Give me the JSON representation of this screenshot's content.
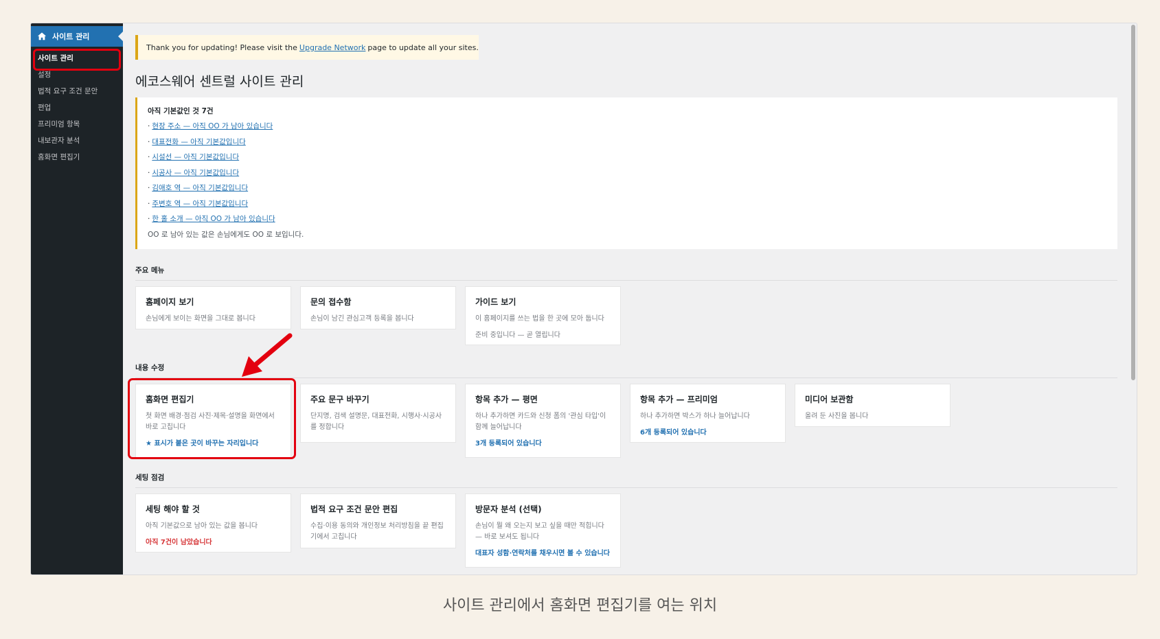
{
  "sidebar": {
    "top_label": "사이트 관리",
    "items": [
      {
        "label": "사이트 관리",
        "current": true
      },
      {
        "label": "설정",
        "current": false
      },
      {
        "label": "법적 요구 조건 문안",
        "current": false
      },
      {
        "label": "편업",
        "current": false
      },
      {
        "label": "프리미엄 항목",
        "current": false
      },
      {
        "label": "내보관자 분석",
        "current": false
      },
      {
        "label": "홈화면 편집기",
        "current": false
      }
    ]
  },
  "notice": {
    "before": "Thank you for updating! Please visit the",
    "link": "Upgrade Network",
    "after": "page to update all your sites."
  },
  "page_title": "에코스웨어 센트럴 사이트 관리",
  "warnings": {
    "title": "아직 기본값인 것 7건",
    "links": [
      "현장 주소 — 아직 OO 가 남아 있습니다",
      "대표전화 — 아직 기본값입니다",
      "시설선 — 아직 기본값입니다",
      "시공사 — 아직 기본값입니다",
      "김애호 역 — 아직 기본값입니다",
      "주변호 역 — 아직 기본값입니다",
      "한 홀 소개 — 아직 OO 가 남아 있습니다"
    ],
    "note": "OO 로 남아 있는 값은 손님에게도 OO 로 보입니다."
  },
  "sections": {
    "main_menu": {
      "label": "주요 메뉴",
      "cards": [
        {
          "title": "홈페이지 보기",
          "desc": "손님에게 보이는 화면을 그대로 봅니다"
        },
        {
          "title": "문의 접수함",
          "desc": "손님이 남긴 관심고객 등록을 봅니다"
        },
        {
          "title": "가이드 보기",
          "desc": "이 홈페이지를 쓰는 법을 한 곳에 모아 둡니다",
          "desc2": "준비 중입니다 — 곧 열립니다"
        }
      ]
    },
    "content_edit": {
      "label": "내용 수정",
      "cards": [
        {
          "title": "홈화면 편집기",
          "desc": "첫 화면 배경·점검 사진·제목·설명을 화면에서 바로 고칩니다",
          "meta": "★ 표시가 붙은 곳이 바꾸는 자리입니다"
        },
        {
          "title": "주요 문구 바꾸기",
          "desc": "단지명, 검색 설명문, 대표전화, 시행사·시공사를 정합니다"
        },
        {
          "title": "항목 추가 — 평면",
          "desc": "하나 추가하면 카드와 신청 폼의 '관심 타입'이 함께 늘어납니다",
          "meta": "3개 등록되어 있습니다"
        },
        {
          "title": "항목 추가 — 프리미엄",
          "desc": "하나 추가하면 박스가 하나 늘어납니다",
          "meta": "6개 등록되어 있습니다"
        },
        {
          "title": "미디어 보관함",
          "desc": "올려 둔 사진을 봅니다"
        }
      ]
    },
    "setup_check": {
      "label": "세팅 점검",
      "cards": [
        {
          "title": "세팅 해야 할 것",
          "desc": "아직 기본값으로 남아 있는 값을 봅니다",
          "meta": "아직 7건이 남았습니다"
        },
        {
          "title": "법적 요구 조건 문안 편집",
          "desc": "수집·이용 동의와 개인정보 처리방침을 끝 편집기에서 고칩니다"
        },
        {
          "title": "방문자 분석 (선택)",
          "desc": "손님이 뭘 왜 오는지 보고 싶을 때만 적힙니다 — 바로 보셔도 됩니다",
          "meta": "대표자 성함·연락처를 채우시면 볼 수 있습니다"
        }
      ]
    }
  },
  "caption": "사이트 관리에서 홈화면 편집기를 여는 위치",
  "colors": {
    "accent": "#2271b1",
    "highlight": "#e3000f",
    "sidebar": "#1d2327",
    "warning_border": "#dba617",
    "alert_text": "#d63638"
  }
}
